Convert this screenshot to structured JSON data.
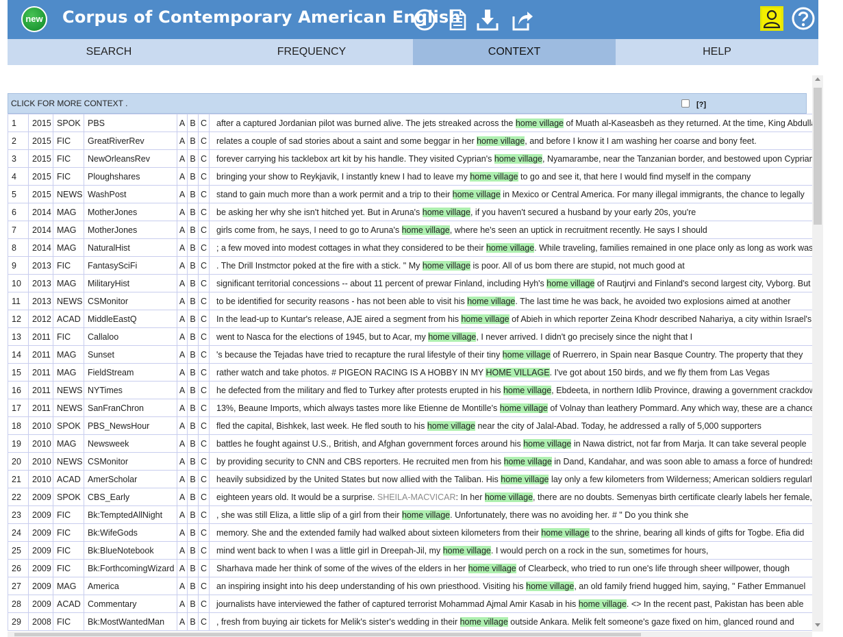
{
  "header": {
    "badge": "new",
    "title": "Corpus of Contemporary American English"
  },
  "tabs": [
    {
      "label": "SEARCH",
      "active": false
    },
    {
      "label": "FREQUENCY",
      "active": false
    },
    {
      "label": "CONTEXT",
      "active": true
    },
    {
      "label": "HELP",
      "active": false
    }
  ],
  "results": {
    "caption": "CLICK FOR MORE CONTEXT .",
    "help_link": "[?]",
    "highlight_color": "#aef0b0",
    "rows": [
      {
        "n": "1",
        "year": "2015",
        "genre": "SPOK",
        "source": "PBS",
        "pre": "after a captured Jordanian pilot was burned alive. The jets streaked across the ",
        "kw": "home village",
        "post": " of Muath al-Kaseasbeh as they returned. At the time, King Abdullah"
      },
      {
        "n": "2",
        "year": "2015",
        "genre": "FIC",
        "source": "GreatRiverRev",
        "pre": "relates a couple of sad stories about a saint and some beggar in her ",
        "kw": "home village",
        "post": ", and before I know it I am washing her coarse and bony feet."
      },
      {
        "n": "3",
        "year": "2015",
        "genre": "FIC",
        "source": "NewOrleansRev",
        "pre": "forever carrying his tacklebox art kit by his handle. They visited Cyprian's ",
        "kw": "home village",
        "post": ", Nyamarambe, near the Tanzanian border, and bestowed upon Cyprian"
      },
      {
        "n": "4",
        "year": "2015",
        "genre": "FIC",
        "source": "Ploughshares",
        "pre": "bringing your show to Reykjavik, I instantly knew I had to leave my ",
        "kw": "home village",
        "post": " to go and see it, that here I would find myself in the company"
      },
      {
        "n": "5",
        "year": "2015",
        "genre": "NEWS",
        "source": "WashPost",
        "pre": "stand to gain much more than a work permit and a trip to their ",
        "kw": "home village",
        "post": " in Mexico or Central America. For many illegal immigrants, the chance to legally"
      },
      {
        "n": "6",
        "year": "2014",
        "genre": "MAG",
        "source": "MotherJones",
        "pre": "be asking her why she isn't hitched yet. But in Aruna's ",
        "kw": "home village",
        "post": ", if you haven't secured a husband by your early 20s, you're"
      },
      {
        "n": "7",
        "year": "2014",
        "genre": "MAG",
        "source": "MotherJones",
        "pre": "girls come from, he says, I need to go to Aruna's ",
        "kw": "home village",
        "post": ", where he's seen an uptick in recruitment recently. He says I should"
      },
      {
        "n": "8",
        "year": "2014",
        "genre": "MAG",
        "source": "NaturalHist",
        "pre": "; a few moved into modest cottages in what they considered to be their ",
        "kw": "home village",
        "post": ". While traveling, families remained in one place only as long as work was"
      },
      {
        "n": "9",
        "year": "2013",
        "genre": "FIC",
        "source": "FantasySciFi",
        "pre": ". The Drill Instmctor poked at the fire with a stick. \" My ",
        "kw": "home village",
        "post": " is poor. All of us bom there are stupid, not much good at"
      },
      {
        "n": "10",
        "year": "2013",
        "genre": "MAG",
        "source": "MilitaryHist",
        "pre": "significant territorial concessions -- about 11 percent of prewar Finland, including Hyh's ",
        "kw": "home village",
        "post": " of Rautjrvi and Finland's second largest city, Vyborg. But"
      },
      {
        "n": "11",
        "year": "2013",
        "genre": "NEWS",
        "source": "CSMonitor",
        "pre": "to be identified for security reasons - has not been able to visit his ",
        "kw": "home village",
        "post": ". The last time he was back, he avoided two explosions aimed at another"
      },
      {
        "n": "12",
        "year": "2012",
        "genre": "ACAD",
        "source": "MiddleEastQ",
        "pre": "In the lead-up to Kuntar's release, AJE aired a segment from his ",
        "kw": "home village",
        "post": " of Abieh in which reporter Zeina Khodr described Nahariya, a city within Israel's"
      },
      {
        "n": "13",
        "year": "2011",
        "genre": "FIC",
        "source": "Callaloo",
        "pre": "went to Nasca for the elections of 1945, but to Acar, my ",
        "kw": "home village",
        "post": ", I never arrived. I didn't go precisely since the night that I"
      },
      {
        "n": "14",
        "year": "2011",
        "genre": "MAG",
        "source": "Sunset",
        "pre": "'s because the Tejadas have tried to recapture the rural lifestyle of their tiny ",
        "kw": "home village",
        "post": " of Ruerrero, in Spain near Basque Country. The property that they"
      },
      {
        "n": "15",
        "year": "2011",
        "genre": "MAG",
        "source": "FieldStream",
        "pre": "rather watch and take photos. # PIGEON RACING IS A HOBBY IN MY ",
        "kw": "HOME VILLAGE",
        "post": ". I've got about 150 birds, and we fly them from Las Vegas"
      },
      {
        "n": "16",
        "year": "2011",
        "genre": "NEWS",
        "source": "NYTimes",
        "pre": "he defected from the military and fled to Turkey after protests erupted in his ",
        "kw": "home village",
        "post": ", Ebdeeta, in northern Idlib Province, drawing a government crackdown"
      },
      {
        "n": "17",
        "year": "2011",
        "genre": "NEWS",
        "source": "SanFranChron",
        "pre": "13%, Beaune Imports, which always tastes more like Etienne de Montille's ",
        "kw": "home village",
        "post": " of Volnay than leathery Pommard. Any which way, these are a chance"
      },
      {
        "n": "18",
        "year": "2010",
        "genre": "SPOK",
        "source": "PBS_NewsHour",
        "pre": "fled the capital, Bishkek, last week. He fled south to his ",
        "kw": "home village",
        "post": " near the city of Jalal-Abad. Today, he addressed a rally of 5,000 supporters"
      },
      {
        "n": "19",
        "year": "2010",
        "genre": "MAG",
        "source": "Newsweek",
        "pre": "battles he fought against U.S., British, and Afghan government forces around his ",
        "kw": "home village",
        "post": " in Nawa district, not far from Marja. It can take several people"
      },
      {
        "n": "20",
        "year": "2010",
        "genre": "NEWS",
        "source": "CSMonitor",
        "pre": "by providing security to CNN and CBS reporters. He recruited men from his ",
        "kw": "home village",
        "post": " in Dand, Kandahar, and was soon able to amass a force of hundreds"
      },
      {
        "n": "21",
        "year": "2010",
        "genre": "ACAD",
        "source": "AmerScholar",
        "pre": "heavily subsidized by the United States but now allied with the Taliban. His ",
        "kw": "home village",
        "post": " lay only a few kilometers from Wilderness; American soldiers regularly"
      },
      {
        "n": "22",
        "year": "2009",
        "genre": "SPOK",
        "source": "CBS_Early",
        "pre": "eighteen years old. It would be a surprise. ",
        "speaker": "SHEILA-MACVICAR",
        "mid": ": In her ",
        "kw": "home village",
        "post": ", there are no doubts. Semenyas birth certificate clearly labels her female, as"
      },
      {
        "n": "23",
        "year": "2009",
        "genre": "FIC",
        "source": "Bk:TemptedAllNight",
        "pre": ", she was still Eliza, a little slip of a girl from their ",
        "kw": "home village",
        "post": ". Unfortunately, there was no avoiding her. # \" Do you think she"
      },
      {
        "n": "24",
        "year": "2009",
        "genre": "FIC",
        "source": "Bk:WifeGods",
        "pre": "memory. She and the extended family had walked about sixteen kilometers from their ",
        "kw": "home village",
        "post": " to the shrine, bearing all kinds of gifts for Togbe. Efia did"
      },
      {
        "n": "25",
        "year": "2009",
        "genre": "FIC",
        "source": "Bk:BlueNotebook",
        "pre": "mind went back to when I was a little girl in Dreepah-Jil, my ",
        "kw": "home village",
        "post": ". I would perch on a rock in the sun, sometimes for hours,"
      },
      {
        "n": "26",
        "year": "2009",
        "genre": "FIC",
        "source": "Bk:ForthcomingWizard",
        "pre": "Sharhava made her think of some of the wives of the elders in her ",
        "kw": "home village",
        "post": " of Clearbeck, who tried to run one's life through sheer willpower, though"
      },
      {
        "n": "27",
        "year": "2009",
        "genre": "MAG",
        "source": "America",
        "pre": "an inspiring insight into his deep understanding of his own priesthood. Visiting his ",
        "kw": "home village",
        "post": ", an old family friend hugged him, saying, \" Father Emmanuel"
      },
      {
        "n": "28",
        "year": "2009",
        "genre": "ACAD",
        "source": "Commentary",
        "pre": "journalists have interviewed the father of captured terrorist Mohammad Ajmal Amir Kasab in his ",
        "kw": "home village",
        "post": ". <> In the recent past, Pakistan has been able"
      },
      {
        "n": "29",
        "year": "2008",
        "genre": "FIC",
        "source": "Bk:MostWantedMan",
        "pre": ", fresh from buying air tickets for Melik's sister's wedding in their ",
        "kw": "home village",
        "post": " outside Ankara. Melik felt someone's gaze fixed on him, glanced round and"
      }
    ]
  }
}
